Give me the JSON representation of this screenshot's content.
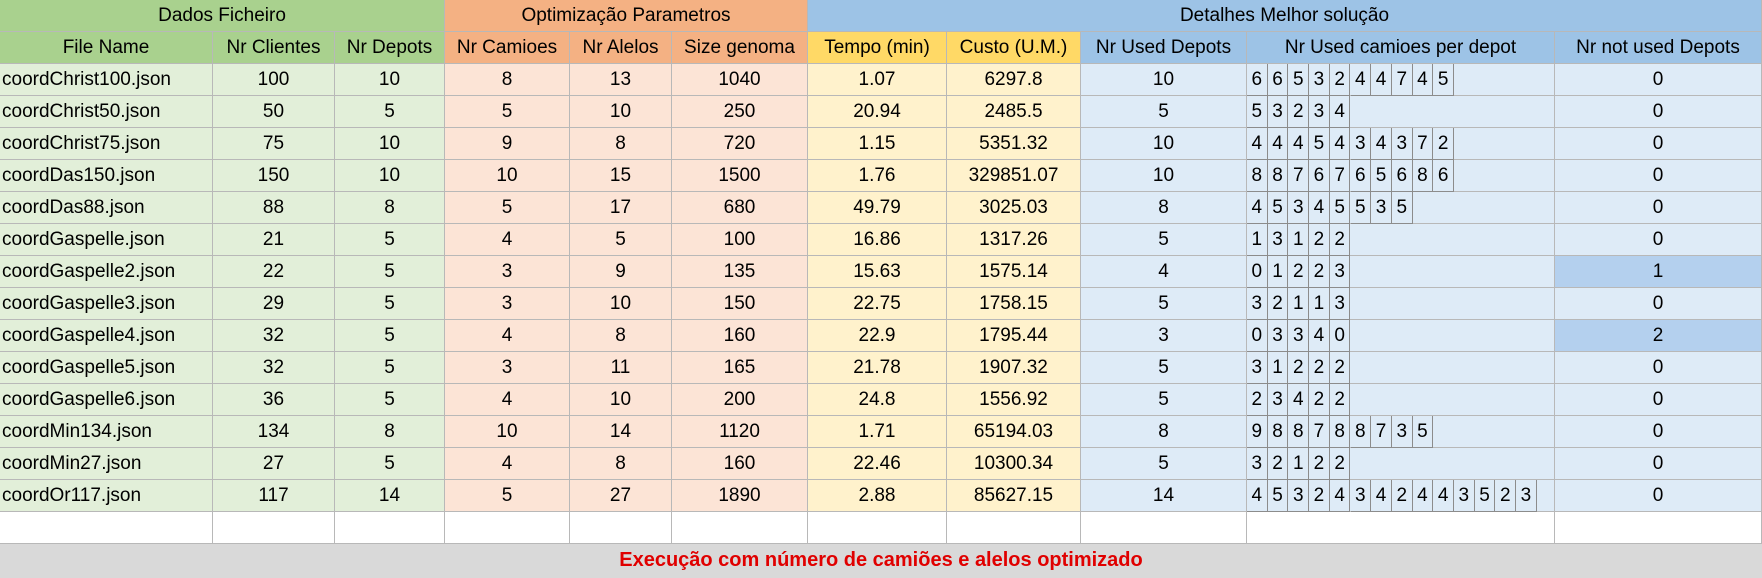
{
  "groups": {
    "dados": "Dados Ficheiro",
    "optim": "Optimização Parametros",
    "detalhes": "Detalhes Melhor solução"
  },
  "headers": {
    "file_name": "File Name",
    "nr_clientes": "Nr Clientes",
    "nr_depots": "Nr Depots",
    "nr_camioes": "Nr Camioes",
    "nr_alelos": "Nr Alelos",
    "size_genoma": "Size genoma",
    "tempo": "Tempo (min)",
    "custo": "Custo (U.M.)",
    "nr_used_depots": "Nr Used Depots",
    "nr_used_camioes": "Nr Used camioes per depot",
    "nr_not_used": "Nr not used Depots"
  },
  "rows": [
    {
      "file": "coordChrist100.json",
      "clientes": "100",
      "depots": "10",
      "camioes": "8",
      "alelos": "13",
      "genoma": "1040",
      "tempo": "1.07",
      "custo": "6297.8",
      "used": "10",
      "trucks": [
        "6",
        "6",
        "5",
        "3",
        "2",
        "4",
        "4",
        "7",
        "4",
        "5"
      ],
      "notused": "0"
    },
    {
      "file": "coordChrist50.json",
      "clientes": "50",
      "depots": "5",
      "camioes": "5",
      "alelos": "10",
      "genoma": "250",
      "tempo": "20.94",
      "custo": "2485.5",
      "used": "5",
      "trucks": [
        "5",
        "3",
        "2",
        "3",
        "4"
      ],
      "notused": "0"
    },
    {
      "file": "coordChrist75.json",
      "clientes": "75",
      "depots": "10",
      "camioes": "9",
      "alelos": "8",
      "genoma": "720",
      "tempo": "1.15",
      "custo": "5351.32",
      "used": "10",
      "trucks": [
        "4",
        "4",
        "4",
        "5",
        "4",
        "3",
        "4",
        "3",
        "7",
        "2"
      ],
      "notused": "0"
    },
    {
      "file": "coordDas150.json",
      "clientes": "150",
      "depots": "10",
      "camioes": "10",
      "alelos": "15",
      "genoma": "1500",
      "tempo": "1.76",
      "custo": "329851.07",
      "used": "10",
      "trucks": [
        "8",
        "8",
        "7",
        "6",
        "7",
        "6",
        "5",
        "6",
        "8",
        "6"
      ],
      "notused": "0"
    },
    {
      "file": "coordDas88.json",
      "clientes": "88",
      "depots": "8",
      "camioes": "5",
      "alelos": "17",
      "genoma": "680",
      "tempo": "49.79",
      "custo": "3025.03",
      "used": "8",
      "trucks": [
        "4",
        "5",
        "3",
        "4",
        "5",
        "5",
        "3",
        "5"
      ],
      "notused": "0"
    },
    {
      "file": "coordGaspelle.json",
      "clientes": "21",
      "depots": "5",
      "camioes": "4",
      "alelos": "5",
      "genoma": "100",
      "tempo": "16.86",
      "custo": "1317.26",
      "used": "5",
      "trucks": [
        "1",
        "3",
        "1",
        "2",
        "2"
      ],
      "notused": "0"
    },
    {
      "file": "coordGaspelle2.json",
      "clientes": "22",
      "depots": "5",
      "camioes": "3",
      "alelos": "9",
      "genoma": "135",
      "tempo": "15.63",
      "custo": "1575.14",
      "used": "4",
      "trucks": [
        "0",
        "1",
        "2",
        "2",
        "3"
      ],
      "notused": "1",
      "hl": true
    },
    {
      "file": "coordGaspelle3.json",
      "clientes": "29",
      "depots": "5",
      "camioes": "3",
      "alelos": "10",
      "genoma": "150",
      "tempo": "22.75",
      "custo": "1758.15",
      "used": "5",
      "trucks": [
        "3",
        "2",
        "1",
        "1",
        "3"
      ],
      "notused": "0"
    },
    {
      "file": "coordGaspelle4.json",
      "clientes": "32",
      "depots": "5",
      "camioes": "4",
      "alelos": "8",
      "genoma": "160",
      "tempo": "22.9",
      "custo": "1795.44",
      "used": "3",
      "trucks": [
        "0",
        "3",
        "3",
        "4",
        "0"
      ],
      "notused": "2",
      "hl": true
    },
    {
      "file": "coordGaspelle5.json",
      "clientes": "32",
      "depots": "5",
      "camioes": "3",
      "alelos": "11",
      "genoma": "165",
      "tempo": "21.78",
      "custo": "1907.32",
      "used": "5",
      "trucks": [
        "3",
        "1",
        "2",
        "2",
        "2"
      ],
      "notused": "0"
    },
    {
      "file": "coordGaspelle6.json",
      "clientes": "36",
      "depots": "5",
      "camioes": "4",
      "alelos": "10",
      "genoma": "200",
      "tempo": "24.8",
      "custo": "1556.92",
      "used": "5",
      "trucks": [
        "2",
        "3",
        "4",
        "2",
        "2"
      ],
      "notused": "0"
    },
    {
      "file": "coordMin134.json",
      "clientes": "134",
      "depots": "8",
      "camioes": "10",
      "alelos": "14",
      "genoma": "1120",
      "tempo": "1.71",
      "custo": "65194.03",
      "used": "8",
      "trucks": [
        "9",
        "8",
        "8",
        "7",
        "8",
        "8",
        "7",
        "3",
        "5"
      ],
      "notused": "0"
    },
    {
      "file": "coordMin27.json",
      "clientes": "27",
      "depots": "5",
      "camioes": "4",
      "alelos": "8",
      "genoma": "160",
      "tempo": "22.46",
      "custo": "10300.34",
      "used": "5",
      "trucks": [
        "3",
        "2",
        "1",
        "2",
        "2"
      ],
      "notused": "0"
    },
    {
      "file": "coordOr117.json",
      "clientes": "117",
      "depots": "14",
      "camioes": "5",
      "alelos": "27",
      "genoma": "1890",
      "tempo": "2.88",
      "custo": "85627.15",
      "used": "14",
      "trucks": [
        "4",
        "5",
        "3",
        "2",
        "4",
        "3",
        "4",
        "2",
        "4",
        "4",
        "3",
        "5",
        "2",
        "3"
      ],
      "notused": "0"
    }
  ],
  "footer": "Execução com número de camiões e alelos optimizado"
}
